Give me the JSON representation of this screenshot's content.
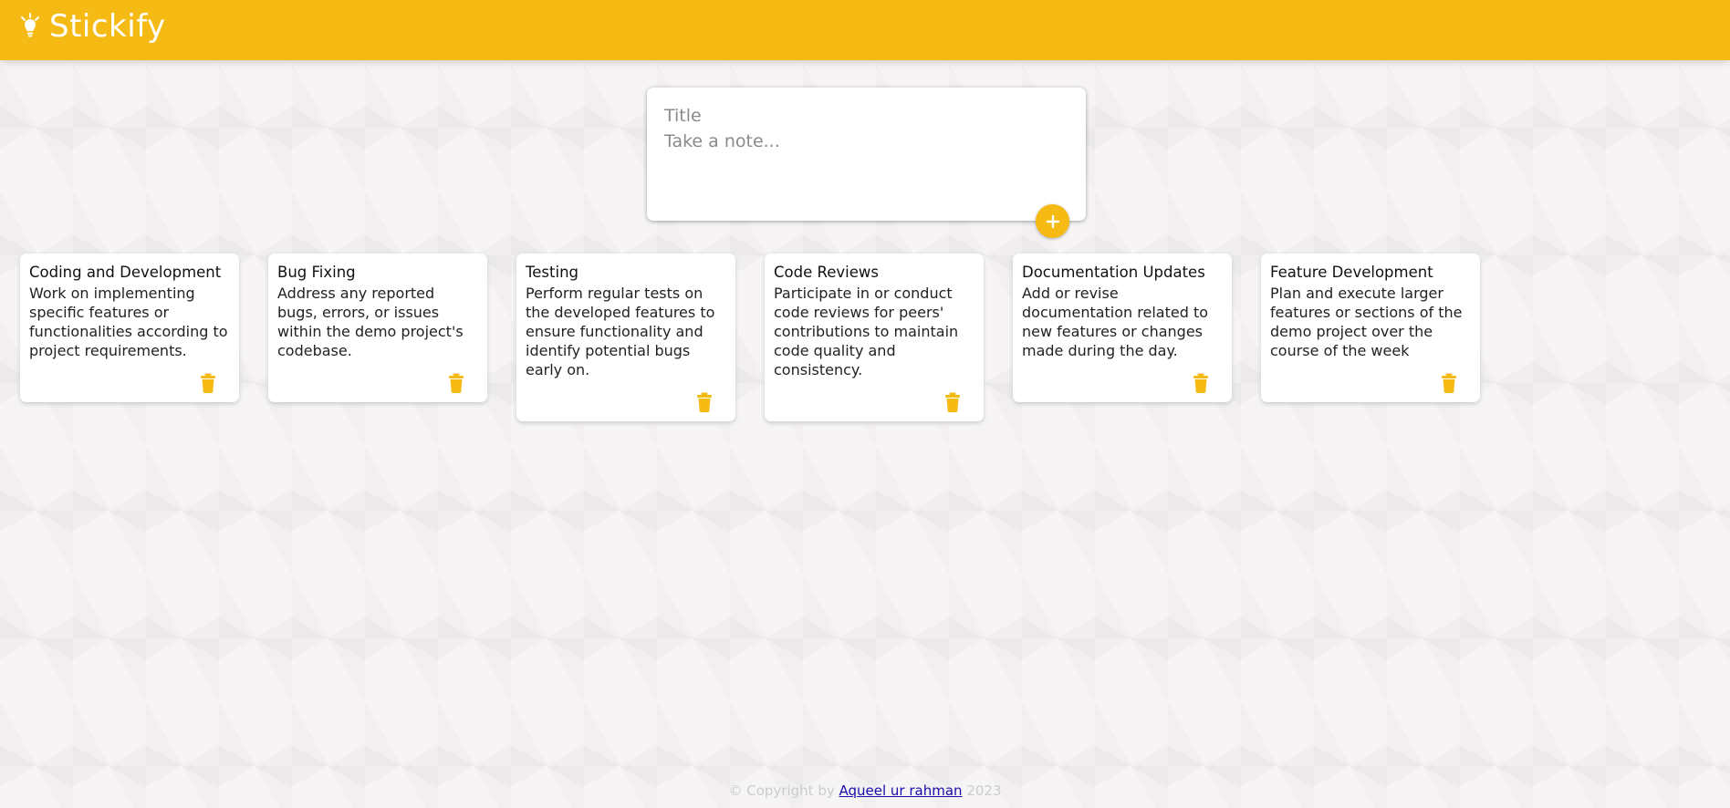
{
  "header": {
    "title": "Stickify",
    "icon": "lightbulb-icon",
    "background_color": "#f5ba13"
  },
  "create_note": {
    "title_placeholder": "Title",
    "content_placeholder": "Take a note...",
    "add_icon": "plus-icon"
  },
  "notes": [
    {
      "title": "Coding and Development",
      "content": "Work on implementing specific features or functionalities according to project requirements.",
      "delete_icon": "trash-icon"
    },
    {
      "title": "Bug Fixing",
      "content": "Address any reported bugs, errors, or issues within the demo project's codebase.",
      "delete_icon": "trash-icon"
    },
    {
      "title": "Testing",
      "content": "Perform regular tests on the developed features to ensure functionality and identify potential bugs early on.",
      "delete_icon": "trash-icon"
    },
    {
      "title": "Code Reviews",
      "content": "Participate in or conduct code reviews for peers' contributions to maintain code quality and consistency.",
      "delete_icon": "trash-icon"
    },
    {
      "title": "Documentation Updates",
      "content": "Add or revise documentation related to new features or changes made during the day.",
      "delete_icon": "trash-icon"
    },
    {
      "title": "Feature Development",
      "content": "Plan and execute larger features or sections of the demo project over the course of the week",
      "delete_icon": "trash-icon"
    }
  ],
  "footer": {
    "prefix": "© Copyright by",
    "author": "Aqueel ur rahman",
    "year": "2023"
  },
  "colors": {
    "accent": "#f5ba13",
    "page_background": "#f6f4f4",
    "link": "#1a0dab"
  }
}
